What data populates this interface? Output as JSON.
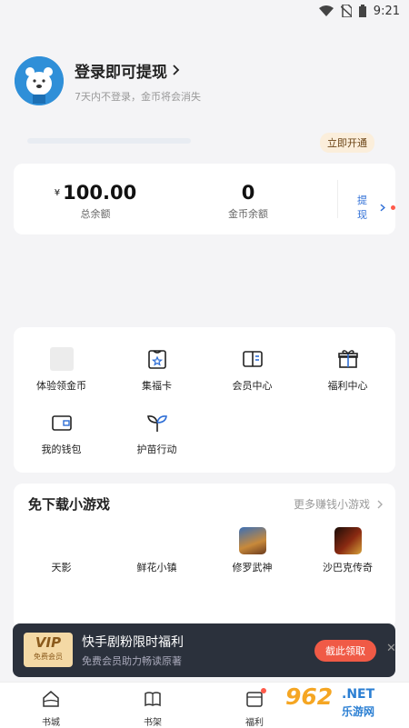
{
  "status_bar": {
    "time": "9:21"
  },
  "profile": {
    "title": "登录即可提现",
    "subtitle": "7天内不登录，金币将会消失"
  },
  "vip": {
    "open_label": "立即开通"
  },
  "balance": {
    "currency": "¥",
    "total_value": "100.00",
    "total_label": "总余额",
    "coin_value": "0",
    "coin_label": "金币余额",
    "withdraw_label": "提现"
  },
  "menu": {
    "items": [
      {
        "label": "体验领金币",
        "icon": "coin-placeholder-icon"
      },
      {
        "label": "集福卡",
        "icon": "card-star-icon"
      },
      {
        "label": "会员中心",
        "icon": "book-icon"
      },
      {
        "label": "福利中心",
        "icon": "gift-icon"
      },
      {
        "label": "我的钱包",
        "icon": "wallet-icon"
      },
      {
        "label": "护苗行动",
        "icon": "sprout-icon"
      }
    ]
  },
  "games": {
    "title": "免下载小游戏",
    "more_label": "更多赚钱小游戏",
    "items": [
      {
        "label": "天影"
      },
      {
        "label": "鲜花小镇"
      },
      {
        "label": "修罗武神"
      },
      {
        "label": "沙巴克传奇"
      }
    ]
  },
  "banner": {
    "badge_main": "VIP",
    "badge_sub": "免费会员",
    "title": "快手剧粉限时福利",
    "subtitle": "免费会员助力畅读原著",
    "button": "截此领取"
  },
  "tabs": [
    {
      "label": "书城",
      "icon": "home-icon"
    },
    {
      "label": "书架",
      "icon": "bookshelf-icon"
    },
    {
      "label": "福利",
      "icon": "welfare-icon"
    }
  ],
  "watermark": {
    "num": "962",
    "net": ".NET",
    "cn": "乐游网"
  },
  "colors": {
    "accent": "#2e6ed6",
    "red": "#f05a46",
    "banner_bg": "#2b313c"
  }
}
